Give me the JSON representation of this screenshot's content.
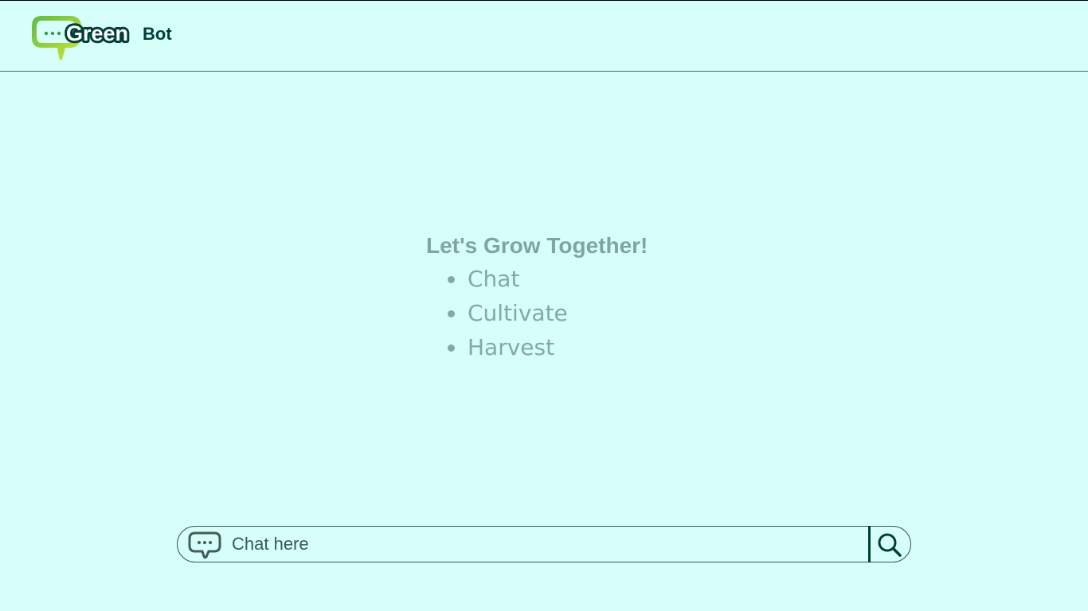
{
  "header": {
    "logo_word_1": "Green",
    "logo_word_2": "Bot"
  },
  "hero": {
    "title": "Let's Grow Together!",
    "items": [
      "Chat",
      "Cultivate",
      "Harvest"
    ]
  },
  "chat": {
    "placeholder": "Chat here",
    "chat_icon": "chat-bubble-icon",
    "search_icon": "search-icon"
  },
  "colors": {
    "background": "#d7fff9",
    "brand_dark": "#003f38",
    "brand_green": "#6cc24a",
    "brand_lime": "#c5e03a",
    "hero_text": "#7ea6a0"
  }
}
